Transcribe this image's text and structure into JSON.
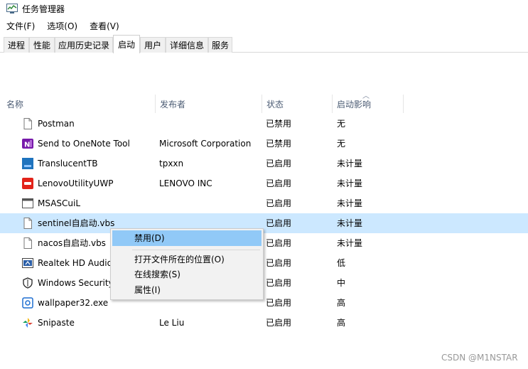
{
  "window": {
    "title": "任务管理器"
  },
  "menu": [
    "文件(F)",
    "选项(O)",
    "查看(V)"
  ],
  "tabs": [
    "进程",
    "性能",
    "应用历史记录",
    "启动",
    "用户",
    "详细信息",
    "服务"
  ],
  "active_tab": "启动",
  "columns": {
    "name": "名称",
    "publisher": "发布者",
    "status": "状态",
    "impact": "启动影响"
  },
  "rows": [
    {
      "name": "Postman",
      "publisher": "",
      "status": "已禁用",
      "impact": "无",
      "icon": "file-icon"
    },
    {
      "name": "Send to OneNote Tool",
      "publisher": "Microsoft Corporation",
      "status": "已禁用",
      "impact": "无",
      "icon": "onenote-icon"
    },
    {
      "name": "TranslucentTB",
      "publisher": "tpxxn",
      "status": "已启用",
      "impact": "未计量",
      "icon": "translucenttb-icon"
    },
    {
      "name": "LenovoUtilityUWP",
      "publisher": "LENOVO INC",
      "status": "已启用",
      "impact": "未计量",
      "icon": "lenovo-icon"
    },
    {
      "name": "MSASCuiL",
      "publisher": "",
      "status": "已启用",
      "impact": "未计量",
      "icon": "window-icon"
    },
    {
      "name": "sentinel自启动.vbs",
      "publisher": "",
      "status": "已启用",
      "impact": "未计量",
      "icon": "file-icon"
    },
    {
      "name": "nacos自启动.vbs",
      "publisher": "",
      "status": "已启用",
      "impact": "未计量",
      "icon": "file-icon"
    },
    {
      "name": "Realtek HD Audio",
      "publisher": "",
      "status": "已启用",
      "impact": "低",
      "icon": "realtek-icon"
    },
    {
      "name": "Windows Security",
      "publisher": "",
      "status": "已启用",
      "impact": "中",
      "icon": "shield-icon"
    },
    {
      "name": "wallpaper32.exe",
      "publisher": "",
      "status": "已启用",
      "impact": "高",
      "icon": "wallpaper-icon"
    },
    {
      "name": "Snipaste",
      "publisher": "Le Liu",
      "status": "已启用",
      "impact": "高",
      "icon": "snipaste-icon"
    }
  ],
  "selected_row": "sentinel自启动.vbs",
  "context_menu": {
    "disable": "禁用(D)",
    "open_location": "打开文件所在的位置(O)",
    "search_online": "在线搜索(S)",
    "properties": "属性(I)"
  },
  "watermark": "CSDN @M1NSTAR",
  "colors": {
    "selection": "#cce8ff",
    "menu_highlight": "#91c9f7",
    "header_text": "#4c5c74"
  }
}
